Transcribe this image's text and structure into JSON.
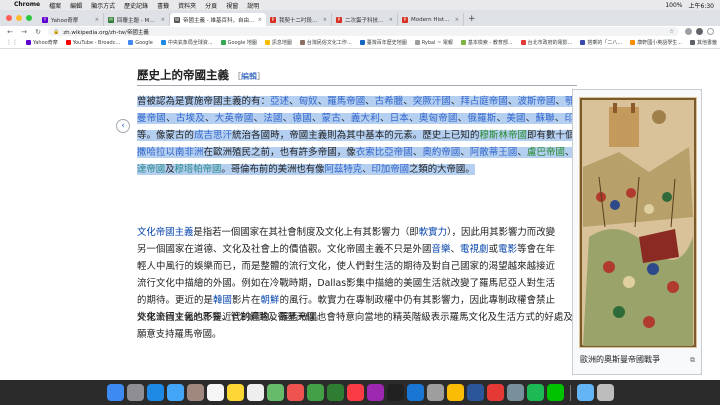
{
  "menubar": {
    "apple": "",
    "items": [
      "Chrome",
      "檔案",
      "編輯",
      "顯示方式",
      "歷史記錄",
      "書籤",
      "資料夾",
      "分頁",
      "視窗",
      "說明"
    ],
    "time": "上午6:30",
    "battery": "100%"
  },
  "tabs": [
    {
      "title": "Yahoo奇摩",
      "color": "#5f01d1",
      "glyph": "Y"
    },
    {
      "title": "回覆主題 - Mobile01",
      "color": "#2e7d32",
      "glyph": "M"
    },
    {
      "title": "帝國主義 - 維基百科，自由的百科全書",
      "color": "#555555",
      "glyph": "W",
      "active": true
    },
    {
      "title": "我契十二吋段｜半的金屬",
      "color": "#d93025",
      "glyph": "P"
    },
    {
      "title": "二次蛋子科技革命—量子電腦與...",
      "color": "#d93025",
      "glyph": "P"
    },
    {
      "title": "Modern Historian XXI Century",
      "color": "#d93025",
      "glyph": "P"
    }
  ],
  "toolbar": {
    "back": "←",
    "forward": "→",
    "reload": "↻",
    "url": "zh.wikipedia.org/zh-tw/帝國主義"
  },
  "bookmarks": [
    {
      "label": "Yahoo奇摩",
      "color": "#5f01d1"
    },
    {
      "label": "YouTube - Broadc...",
      "color": "#ff0000"
    },
    {
      "label": "Google",
      "color": "#4285f4"
    },
    {
      "label": "中央氣象局全球資...",
      "color": "#1e88e5"
    },
    {
      "label": "Google 地圖",
      "color": "#34a853"
    },
    {
      "label": "訊息地圖",
      "color": "#fbbc05"
    },
    {
      "label": "台灣民俗文化工作...",
      "color": "#8d6e63"
    },
    {
      "label": "臺灣百年歷史地圖",
      "color": "#1565c0"
    },
    {
      "label": "Rybal ~ 電報",
      "color": "#9e9e9e"
    },
    {
      "label": "基本檢索 - 教育部...",
      "color": "#7cb342"
    },
    {
      "label": "台北市政府的電影...",
      "color": "#e53935"
    },
    {
      "label": "搭乘的「二八...",
      "color": "#3949ab"
    },
    {
      "label": "康軒國小英語學生...",
      "color": "#fb8c00"
    }
  ],
  "bookmarks_other": "其他書籤",
  "article": {
    "heading": "歷史上的帝國主義",
    "edit_open": "［",
    "edit": "編輯",
    "edit_close": "］",
    "p1": [
      {
        "t": "曾被認為是實施帝國主義的有：",
        "c": ""
      },
      {
        "t": "亞述",
        "c": "lnk2"
      },
      {
        "t": "、",
        "c": ""
      },
      {
        "t": "匈奴",
        "c": "lnk2"
      },
      {
        "t": "、",
        "c": ""
      },
      {
        "t": "羅馬帝國",
        "c": "lnk2"
      },
      {
        "t": "、",
        "c": ""
      },
      {
        "t": "古希臘",
        "c": "lnk2"
      },
      {
        "t": "、",
        "c": ""
      },
      {
        "t": "突厥汗國",
        "c": "lnk2"
      },
      {
        "t": "、",
        "c": ""
      },
      {
        "t": "拜占庭帝國",
        "c": "lnk2"
      },
      {
        "t": "、",
        "c": ""
      },
      {
        "t": "波斯帝國",
        "c": "lnk2"
      },
      {
        "t": "、",
        "c": ""
      },
      {
        "t": "鄂圖曼帝國",
        "c": "lnk2"
      },
      {
        "t": "、",
        "c": ""
      },
      {
        "t": "古埃及",
        "c": "lnk2"
      },
      {
        "t": "、",
        "c": ""
      },
      {
        "t": "大英帝國",
        "c": "lnk2"
      },
      {
        "t": "、",
        "c": ""
      },
      {
        "t": "法國",
        "c": "lnk2"
      },
      {
        "t": "、",
        "c": ""
      },
      {
        "t": "德國",
        "c": "lnk2"
      },
      {
        "t": "、",
        "c": ""
      },
      {
        "t": "蒙古",
        "c": "lnk2"
      },
      {
        "t": "、",
        "c": ""
      },
      {
        "t": "義大利",
        "c": "lnk2"
      },
      {
        "t": "、",
        "c": ""
      },
      {
        "t": "日本",
        "c": "lnk2"
      },
      {
        "t": "、",
        "c": ""
      },
      {
        "t": "奧匈帝國",
        "c": "lnk2"
      },
      {
        "t": "、",
        "c": ""
      },
      {
        "t": "俄羅斯",
        "c": "lnk2"
      },
      {
        "t": "、",
        "c": ""
      },
      {
        "t": "美國",
        "c": "lnk2"
      },
      {
        "t": "、",
        "c": ""
      },
      {
        "t": "蘇聯",
        "c": "lnk2"
      },
      {
        "t": "、",
        "c": ""
      },
      {
        "t": "印度",
        "c": "lnk2"
      },
      {
        "t": "等。像蒙古的",
        "c": ""
      },
      {
        "t": "成吉思汗",
        "c": "lnk2"
      },
      {
        "t": "統治各國時，帝國主義則為其中基本的元素。歷史上已知的",
        "c": ""
      },
      {
        "t": "穆斯林帝國",
        "c": "green"
      },
      {
        "t": "即有數十個，",
        "c": ""
      },
      {
        "t": "撒哈拉以南非洲",
        "c": "lnk2"
      },
      {
        "t": "在歐洲殖民之前，也有許多帝國，像",
        "c": ""
      },
      {
        "t": "衣索比亞帝國",
        "c": "lnk2"
      },
      {
        "t": "、",
        "c": ""
      },
      {
        "t": "奧約帝國",
        "c": "lnk2"
      },
      {
        "t": "、",
        "c": ""
      },
      {
        "t": "阿散蒂王國",
        "c": "lnk2"
      },
      {
        "t": "、",
        "c": ""
      },
      {
        "t": "盧巴帝國",
        "c": "green"
      },
      {
        "t": "、",
        "c": ""
      },
      {
        "t": "倫達帝國",
        "c": "teal"
      },
      {
        "t": "及",
        "c": ""
      },
      {
        "t": "穆塔帕帝國",
        "c": "teal"
      },
      {
        "t": "。哥倫布前的美洲也有像",
        "c": ""
      },
      {
        "t": "阿茲特克",
        "c": "lnk2"
      },
      {
        "t": "、",
        "c": ""
      },
      {
        "t": "印加帝國",
        "c": "lnk2"
      },
      {
        "t": "之類的大帝國。",
        "c": ""
      }
    ],
    "p2": [
      {
        "t": "文化帝國主義",
        "c": "lnk"
      },
      {
        "t": "是指若一個國家在其社會制度及文化上有其影響力（即",
        "c": ""
      },
      {
        "t": "軟實力",
        "c": "lnk"
      },
      {
        "t": "），因此用其影響力而改變另一個國家在道德、文化及社會上的價值觀。文化帝國主義不只是外國",
        "c": ""
      },
      {
        "t": "音樂",
        "c": "lnk"
      },
      {
        "t": "、",
        "c": ""
      },
      {
        "t": "電視劇",
        "c": "lnk"
      },
      {
        "t": "或",
        "c": ""
      },
      {
        "t": "電影",
        "c": "lnk"
      },
      {
        "t": "等會在年輕人中風行的娛樂而已，而是整體的流行文化，使人們對生活的期待及對自己國家的渴望越來越接近流行文化中描繪的外國。例如在冷戰時期，Dallas影集中描繪的美國生活就改變了羅馬尼亞人對生活的期待。更近的是",
        "c": ""
      },
      {
        "t": "韓國",
        "c": "lnk"
      },
      {
        "t": "影片在",
        "c": ""
      },
      {
        "t": "朝鮮",
        "c": "lnk"
      },
      {
        "t": "的風行。軟實力在專制政權中仍有其影響力，因此專制政權會禁止外來流行文化的影響、管制網路及衛星天線。",
        "c": ""
      }
    ],
    "p3": "文化帝國主義也不是近代的產物，羅馬帝國也會特意向當地的精英階級表示羅馬文化及生活方式的好處及奢華，目的是讓他們比較願意支持羅馬帝國。",
    "caption": "歐洲的奧斯曼帝國戰爭"
  },
  "dock": [
    {
      "name": "finder",
      "color": "#3d8bf2"
    },
    {
      "name": "launchpad",
      "color": "#8e8e93"
    },
    {
      "name": "safari",
      "color": "#1e88e5"
    },
    {
      "name": "mail",
      "color": "#42a5f5"
    },
    {
      "name": "contacts",
      "color": "#a1887f"
    },
    {
      "name": "calendar",
      "color": "#f5f5f5"
    },
    {
      "name": "notes",
      "color": "#fdd835"
    },
    {
      "name": "reminders",
      "color": "#eeeeee"
    },
    {
      "name": "maps",
      "color": "#66bb6a"
    },
    {
      "name": "photos",
      "color": "#ef5350"
    },
    {
      "name": "messages",
      "color": "#43a047"
    },
    {
      "name": "facetime",
      "color": "#2e7d32"
    },
    {
      "name": "music",
      "color": "#fc3c44"
    },
    {
      "name": "podcasts",
      "color": "#9c27b0"
    },
    {
      "name": "tv",
      "color": "#212121"
    },
    {
      "name": "app-store",
      "color": "#1976d2"
    },
    {
      "name": "settings",
      "color": "#9e9e9e"
    },
    {
      "name": "chrome",
      "color": "#fbbc05"
    },
    {
      "name": "word",
      "color": "#2b579a"
    },
    {
      "name": "pdf",
      "color": "#e53935"
    },
    {
      "name": "preview",
      "color": "#78909c"
    },
    {
      "name": "spotify",
      "color": "#1db954"
    },
    {
      "name": "line",
      "color": "#00c300"
    },
    {
      "name": "finder-folder",
      "color": "#64b5f6"
    },
    {
      "name": "trash",
      "color": "#bdbdbd"
    }
  ]
}
